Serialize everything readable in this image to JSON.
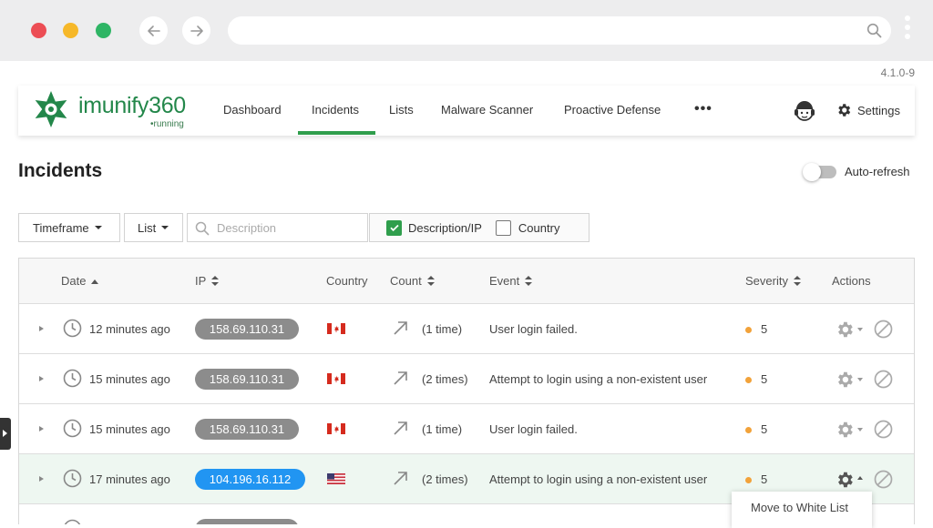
{
  "app": {
    "version": "4.1.0-9",
    "brand": "imunify360",
    "brand_status": "•running",
    "nav": {
      "tabs": [
        {
          "label": "Dashboard"
        },
        {
          "label": "Incidents",
          "active": true
        },
        {
          "label": "Lists"
        },
        {
          "label": "Malware Scanner"
        },
        {
          "label": "Proactive Defense"
        }
      ],
      "more_label": "•••",
      "settings_label": "Settings"
    }
  },
  "page": {
    "title": "Incidents",
    "auto_refresh_label": "Auto-refresh",
    "auto_refresh_on": false
  },
  "filters": {
    "timeframe_label": "Timeframe",
    "list_label": "List",
    "description_placeholder": "Description",
    "description_ip_label": "Description/IP",
    "description_ip_checked": true,
    "country_label": "Country",
    "country_checked": false
  },
  "table": {
    "headers": {
      "date": "Date",
      "ip": "IP",
      "country": "Country",
      "count": "Count",
      "event": "Event",
      "severity": "Severity",
      "actions": "Actions"
    },
    "rows": [
      {
        "time": "12 minutes ago",
        "ip": "158.69.110.31",
        "country": "CA",
        "count": "(1 time)",
        "event": "User login failed.",
        "severity": "5"
      },
      {
        "time": "15 minutes ago",
        "ip": "158.69.110.31",
        "country": "CA",
        "count": "(2 times)",
        "event": "Attempt to login using a non-existent user",
        "severity": "5"
      },
      {
        "time": "15 minutes ago",
        "ip": "158.69.110.31",
        "country": "CA",
        "count": "(1 time)",
        "event": "User login failed.",
        "severity": "5"
      },
      {
        "time": "17 minutes ago",
        "ip": "104.196.16.112",
        "country": "US",
        "count": "(2 times)",
        "event": "Attempt to login using a non-existent user",
        "severity": "5"
      }
    ]
  },
  "action_menu": {
    "item": "Move to White List"
  },
  "colors": {
    "brand_green": "#23874a",
    "accent_green": "#2f9e4c",
    "ip_badge_grey": "#8c8c8c",
    "ip_badge_blue": "#2195f2",
    "severity_orange": "#f2a23a"
  }
}
